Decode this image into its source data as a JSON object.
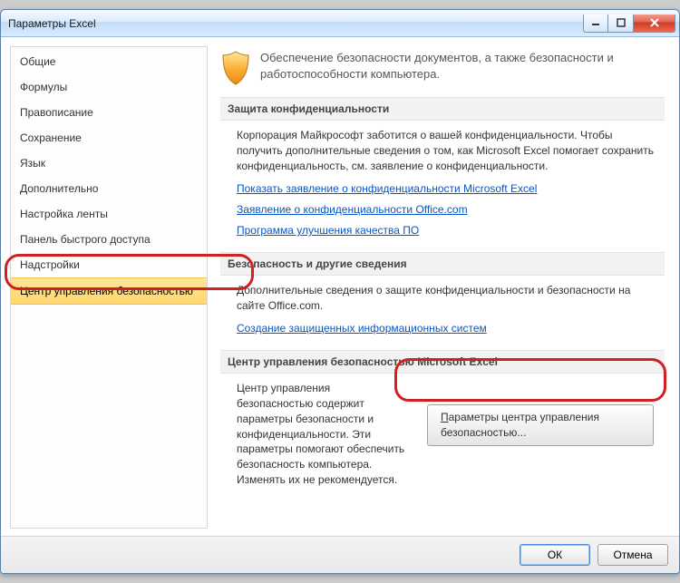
{
  "window": {
    "title": "Параметры Excel"
  },
  "sidebar": {
    "items": [
      {
        "label": "Общие"
      },
      {
        "label": "Формулы"
      },
      {
        "label": "Правописание"
      },
      {
        "label": "Сохранение"
      },
      {
        "label": "Язык"
      },
      {
        "label": "Дополнительно"
      },
      {
        "label": "Настройка ленты"
      },
      {
        "label": "Панель быстрого доступа"
      },
      {
        "label": "Надстройки"
      },
      {
        "label": "Центр управления безопасностью",
        "selected": true
      }
    ]
  },
  "header": {
    "text": "Обеспечение безопасности документов, а также безопасности и работоспособности компьютера."
  },
  "sections": {
    "privacy": {
      "title": "Защита конфиденциальности",
      "body": "Корпорация Майкрософт заботится о вашей конфиденциальности. Чтобы получить дополнительные сведения о том, как Microsoft Excel помогает сохранить конфиденциальность, см. заявление о конфиденциальности.",
      "links": [
        "Показать заявление о конфиденциальности Microsoft Excel",
        "Заявление о конфиденциальности Office.com",
        "Программа улучшения качества ПО"
      ]
    },
    "security": {
      "title": "Безопасность и другие сведения",
      "body": "Дополнительные сведения о защите конфиденциальности и безопасности на сайте Office.com.",
      "links": [
        "Создание защищенных информационных систем"
      ]
    },
    "trust": {
      "title": "Центр управления безопасностью Microsoft Excel",
      "text": "Центр управления безопасностью содержит параметры безопасности и конфиденциальности. Эти параметры помогают обеспечить безопасность компьютера. Изменять их не рекомендуется.",
      "button_underline": "П",
      "button_rest": "араметры центра управления безопасностью..."
    }
  },
  "footer": {
    "ok": "ОК",
    "cancel": "Отмена"
  }
}
